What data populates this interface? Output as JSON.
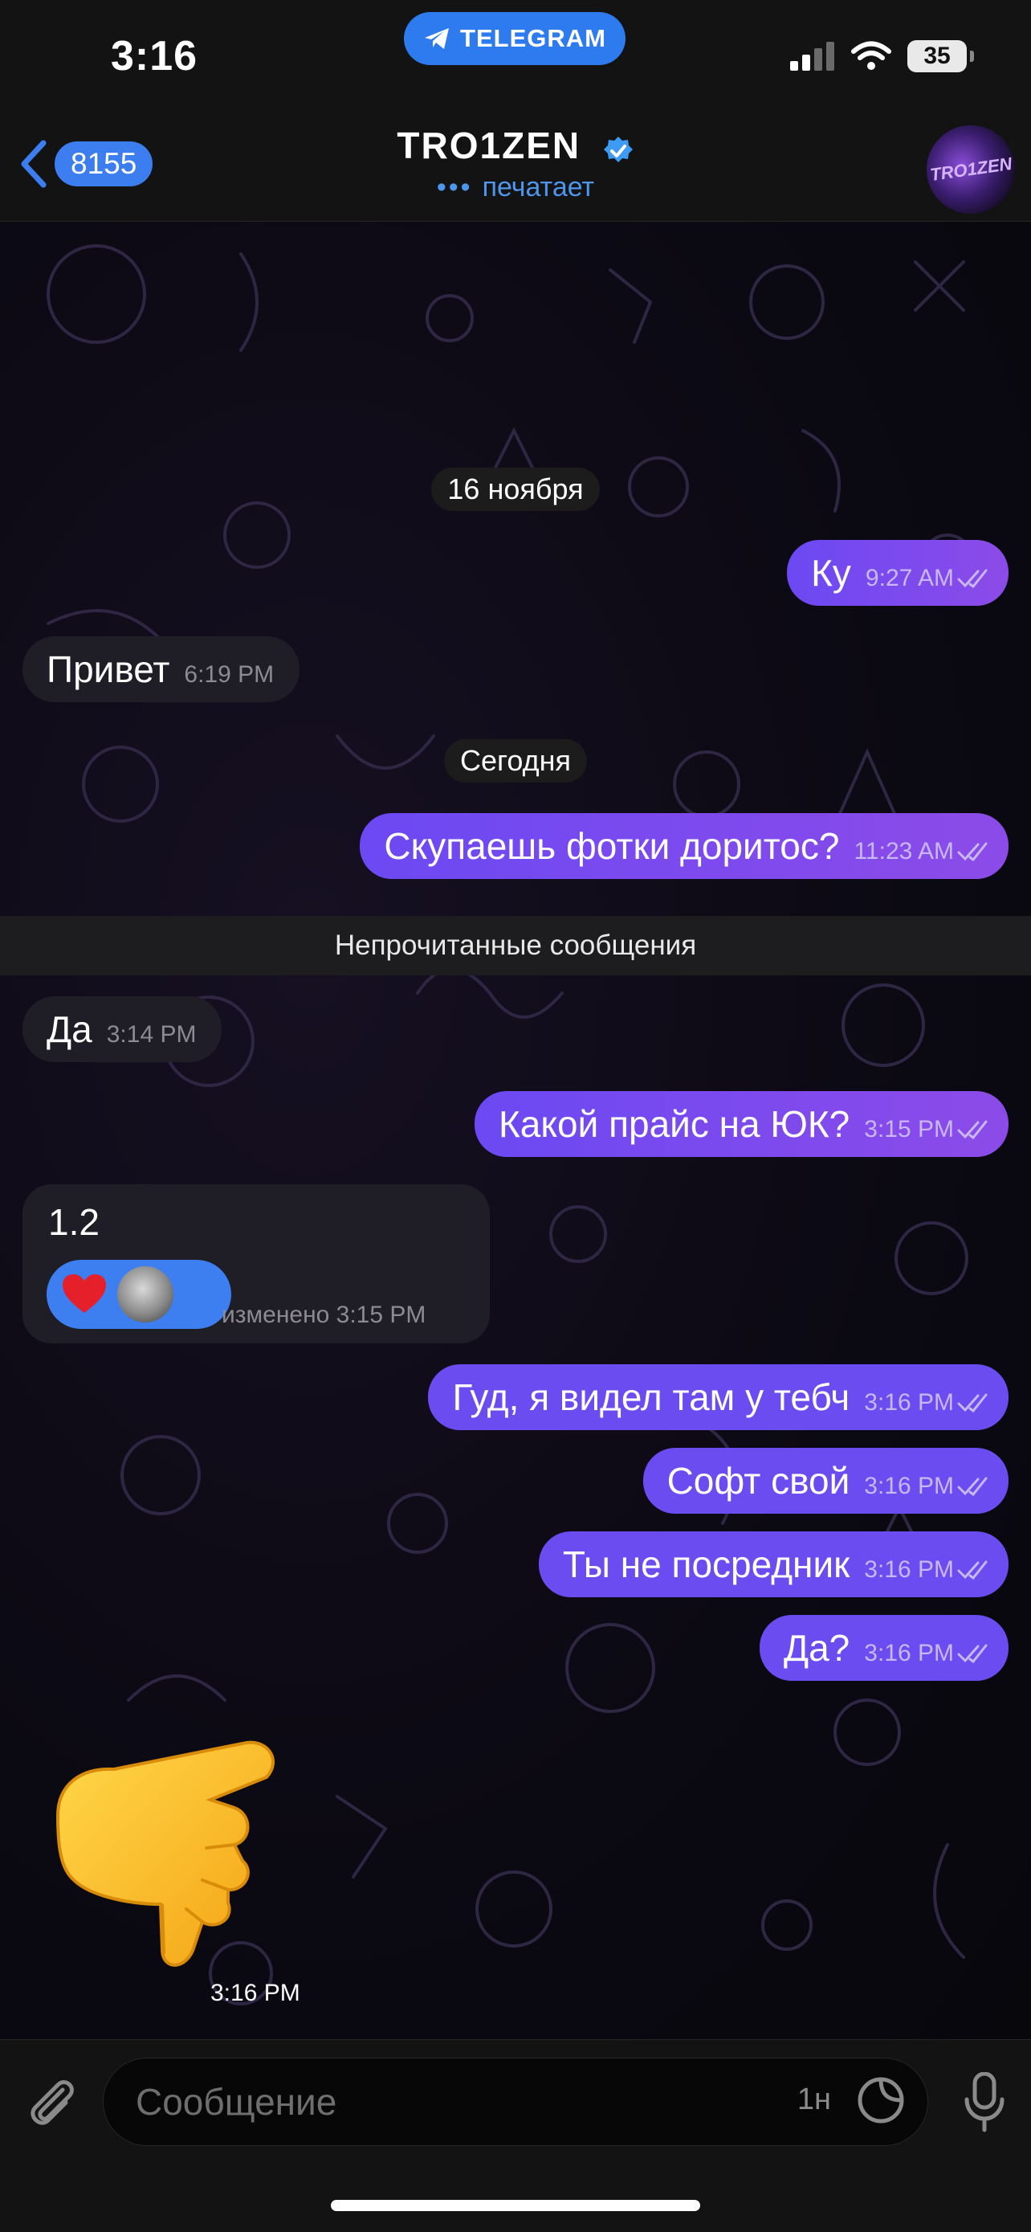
{
  "status_bar": {
    "time": "3:16",
    "app_pill": "TELEGRAM",
    "battery": "35"
  },
  "header": {
    "back_count": "8155",
    "title": "TRO1ZEN",
    "status": "печатает",
    "avatar_text": "TRO1ZEN"
  },
  "messages": [
    {
      "type": "date",
      "text": "16 ноября"
    },
    {
      "type": "out",
      "text": "Ку",
      "time": "9:27 AM"
    },
    {
      "type": "in",
      "text": "Привет",
      "time": "6:19 PM"
    },
    {
      "type": "date",
      "text": "Сегодня"
    },
    {
      "type": "out",
      "text": "Скупаешь фотки доритос?",
      "time": "11:23 AM"
    },
    {
      "type": "unread",
      "text": "Непрочитанные сообщения"
    },
    {
      "type": "in",
      "text": "Да",
      "time": "3:14 PM"
    },
    {
      "type": "out",
      "text": "Какой прайс на ЮК?",
      "time": "3:15 PM"
    },
    {
      "type": "in",
      "text": "1.2",
      "time": "изменено 3:15 PM",
      "reaction": "❤️"
    },
    {
      "type": "out",
      "text": "Гуд, я видел там у тебч",
      "time": "3:16 PM"
    },
    {
      "type": "out",
      "text": "Софт свой",
      "time": "3:16 PM"
    },
    {
      "type": "out",
      "text": "Ты не посредник",
      "time": "3:16 PM"
    },
    {
      "type": "out",
      "text": "Да?",
      "time": "3:16 PM"
    },
    {
      "type": "sticker",
      "emoji": "pointing-down-hand",
      "time": "3:16 PM"
    }
  ],
  "input": {
    "placeholder": "Сообщение",
    "schedule_label": "1н"
  },
  "colors": {
    "accent": "#3c7ef0",
    "out_bubble": "#7a4bef",
    "in_bubble": "#1f1d26",
    "typing": "#4e96ec"
  }
}
